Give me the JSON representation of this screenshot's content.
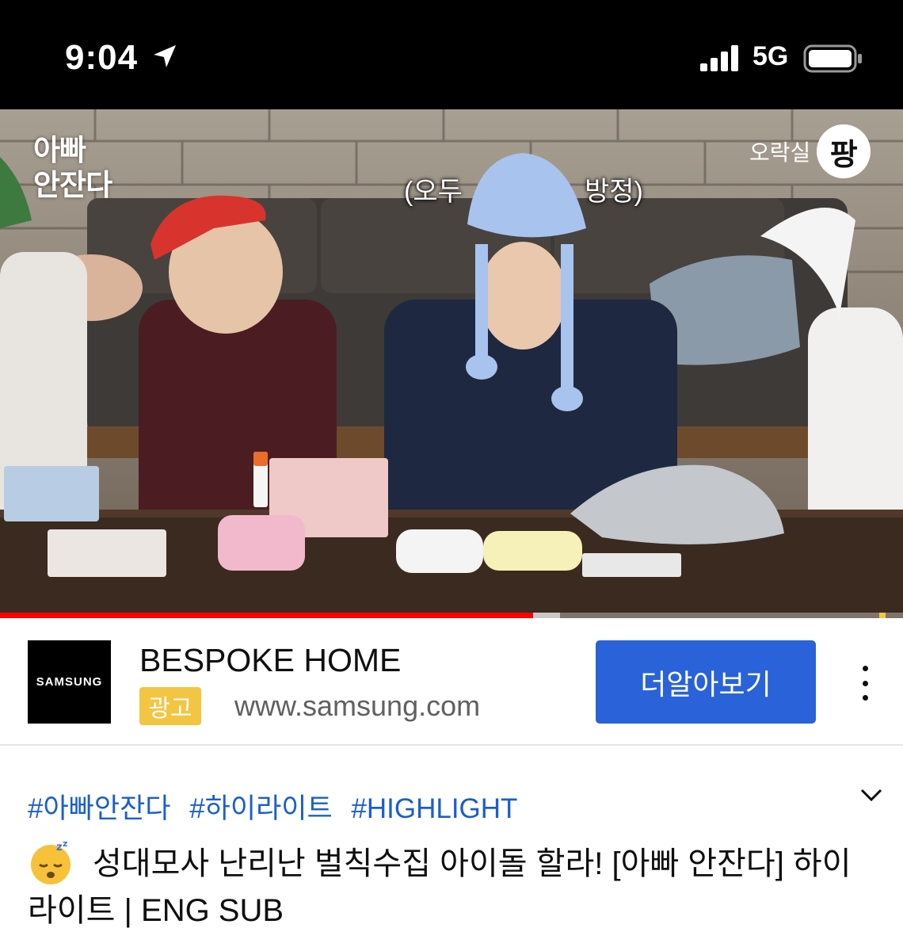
{
  "status_bar": {
    "time": "9:04",
    "network": "5G"
  },
  "video": {
    "show_logo": [
      "아빠",
      "안잔다"
    ],
    "channel_logo_text": "오락실",
    "channel_badge": "팡",
    "subtitle_left": "(오두",
    "subtitle_right": "방정)",
    "progress_fraction": 0.59
  },
  "ad": {
    "logo_text": "SAMSUNG",
    "title": "BESPOKE HOME",
    "badge": "광고",
    "url": "www.samsung.com",
    "cta_label": "더알아보기"
  },
  "description": {
    "hashtags": [
      "#아빠안잔다",
      "#하이라이트",
      "#HIGHLIGHT"
    ],
    "title": "성대모사 난리난 벌칙수집 아이돌 할라! [아빠 안잔다] 하이라이트 | ENG SUB",
    "emoji": "sleeping-face-icon"
  },
  "colors": {
    "accent": "#2962d9",
    "progress": "#ff0000",
    "badge": "#f4c542",
    "link": "#1a5fcb"
  }
}
